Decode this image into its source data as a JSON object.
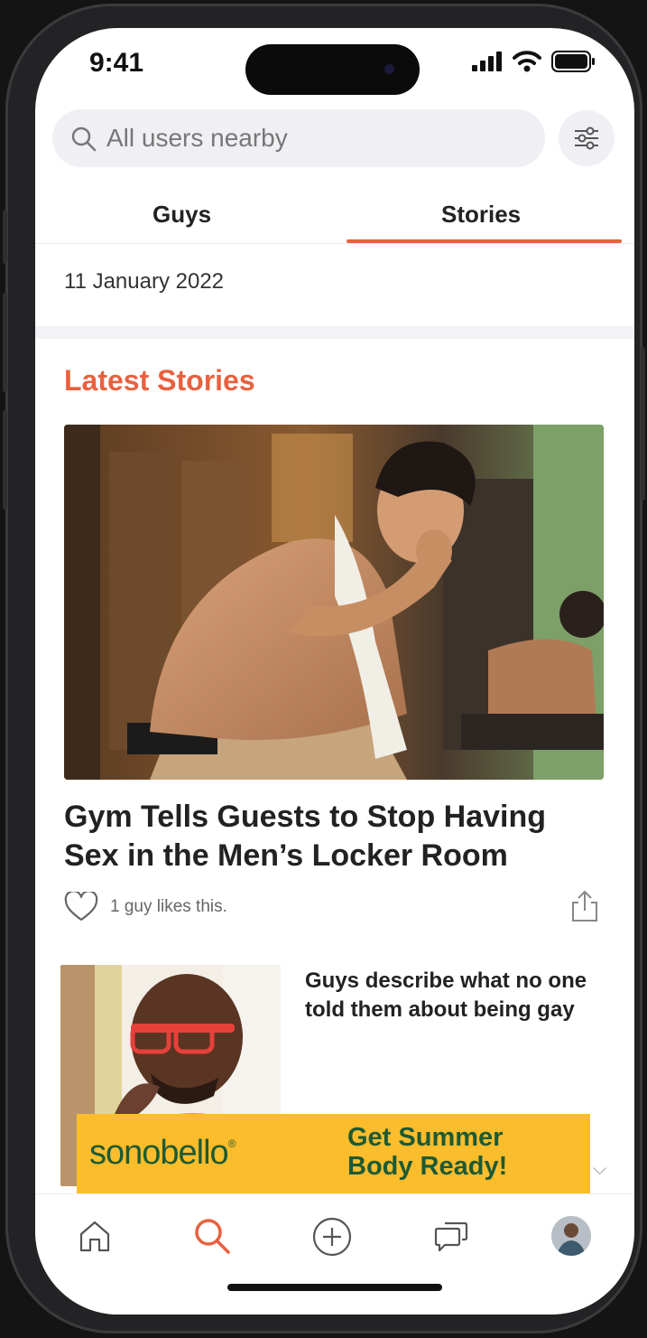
{
  "status_bar": {
    "time": "9:41"
  },
  "search": {
    "placeholder": "All users nearby"
  },
  "tabs": [
    {
      "label": "Guys",
      "active": false
    },
    {
      "label": "Stories",
      "active": true
    }
  ],
  "date": "11 January 2022",
  "section_title": "Latest Stories",
  "featured_story": {
    "headline": "Gym Tells Guests to Stop Having Sex in the Men’s Locker Room",
    "likes_text": "1 guy likes this."
  },
  "second_story": {
    "headline": "Guys describe what no one told them about being gay"
  },
  "ad": {
    "brand": "sonobello",
    "cta": "Get Summer Body Ready!"
  },
  "bottom_nav": [
    "home-icon",
    "search-icon",
    "add-icon",
    "chat-icon",
    "profile-avatar"
  ],
  "colors": {
    "accent": "#e8613f",
    "ad_background": "#fbbd2c",
    "ad_text": "#1e5a33"
  }
}
